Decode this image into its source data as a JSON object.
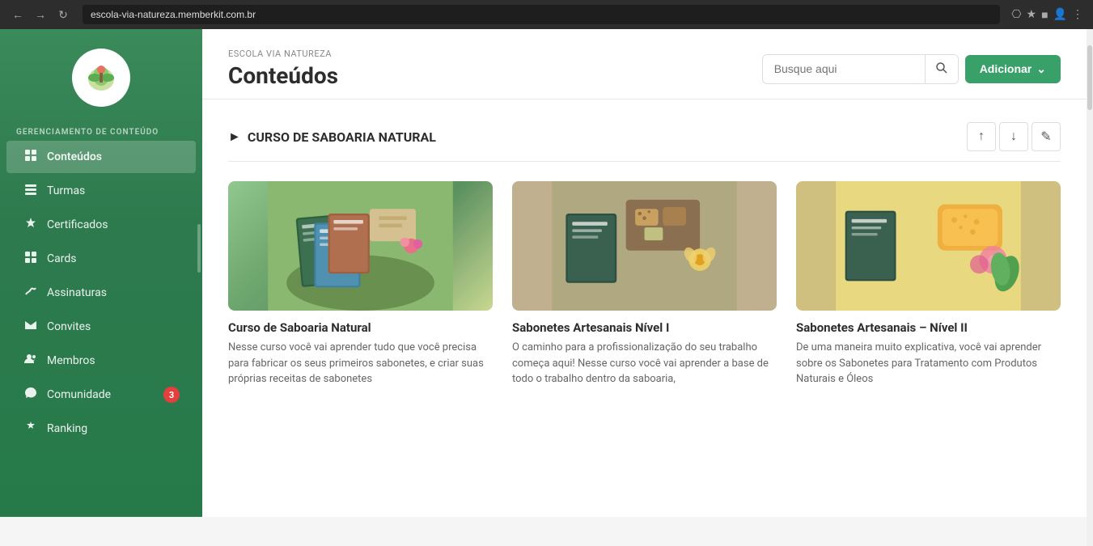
{
  "browser": {
    "url": "escola-via-natureza.memberkit.com.br"
  },
  "sidebar": {
    "school_name": "Via\nNatureza",
    "section_label": "GERENCIAMENTO DE CONTEÚDO",
    "items": [
      {
        "id": "conteudos",
        "label": "Conteúdos",
        "icon": "▦",
        "active": true,
        "badge": null
      },
      {
        "id": "turmas",
        "label": "Turmas",
        "icon": "▤",
        "active": false,
        "badge": null
      },
      {
        "id": "certificados",
        "label": "Certificados",
        "icon": "✦",
        "active": false,
        "badge": null
      },
      {
        "id": "cards",
        "label": "Cards",
        "icon": "⊞",
        "active": false,
        "badge": null
      },
      {
        "id": "assinaturas",
        "label": "Assinaturas",
        "icon": "✎",
        "active": false,
        "badge": null
      },
      {
        "id": "convites",
        "label": "Convites",
        "icon": "✉",
        "active": false,
        "badge": null
      },
      {
        "id": "membros",
        "label": "Membros",
        "icon": "⊕",
        "active": false,
        "badge": null
      },
      {
        "id": "comunidade",
        "label": "Comunidade",
        "icon": "◈",
        "active": false,
        "badge": "3"
      },
      {
        "id": "ranking",
        "label": "Ranking",
        "icon": "⚑",
        "active": false,
        "badge": null
      }
    ]
  },
  "header": {
    "breadcrumb": "ESCOLA VIA NATUREZA",
    "title": "Conteúdos",
    "search_placeholder": "Busque aqui",
    "add_button_label": "Adicionar"
  },
  "course_section": {
    "title": "CURSO DE SABOARIA NATURAL",
    "up_label": "↑",
    "down_label": "↓",
    "edit_label": "✎"
  },
  "cards": [
    {
      "id": "card-1",
      "title": "Curso de Saboaria Natural",
      "description": "Nesse curso você vai aprender tudo que você precisa para fabricar os seus primeiros sabonetes, e criar suas próprias receitas de sabonetes",
      "color1": "#7ec8a0",
      "color2": "#5aad80"
    },
    {
      "id": "card-2",
      "title": "Sabonetes Artesanais Nível I",
      "description": "O caminho para a profissionalização do seu trabalho começa aqui! Nesse curso você vai aprender a base de todo o trabalho dentro da saboaria,",
      "color1": "#8ab8a0",
      "color2": "#c8b890"
    },
    {
      "id": "card-3",
      "title": "Sabonetes Artesanais – Nível II",
      "description": "De uma maneira muito explicativa, você vai aprender sobre os Sabonetes para Tratamento com Produtos Naturais e Óleos",
      "color1": "#e8c870",
      "color2": "#d4a040"
    }
  ]
}
